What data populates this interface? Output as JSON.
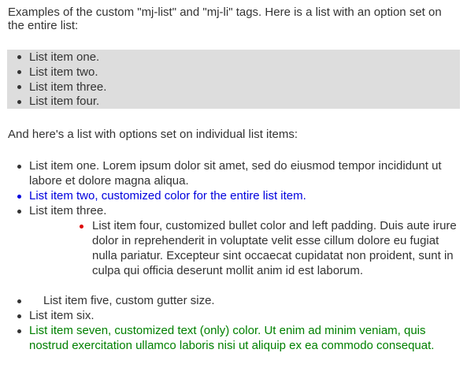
{
  "intro": "Examples of the custom \"mj-list\" and \"mj-li\" tags. Here is a list with an option set on the entire list:",
  "list1": {
    "items": [
      "List item one.",
      "List item two.",
      "List item three.",
      "List item four."
    ]
  },
  "para2": "And here's a list with options set on individual list items:",
  "list2": {
    "item1": "List item one. Lorem ipsum dolor sit amet, sed do eiusmod tempor incididunt ut labore et dolore magna aliqua.",
    "item2": "List item two, customized color for the entire list item.",
    "item3": "List item three.",
    "item4": "List item four, customized bullet color and left padding. Duis aute irure dolor in reprehenderit in voluptate velit esse cillum dolore eu fugiat nulla pariatur. Excepteur sint occaecat cupidatat non proident, sunt in culpa qui officia deserunt mollit anim id est laborum.",
    "item5": "List item five, custom gutter size.",
    "item6": "List item six.",
    "item7": "List item seven, customized text (only) color. Ut enim ad minim veniam, quis nostrud exercitation ullamco laboris nisi ut aliquip ex ea commodo consequat."
  },
  "colors": {
    "text": "#333333",
    "list_background": "#dddddd",
    "item2_color": "#0000dd",
    "item4_bullet": "#dd0000",
    "item7_color": "#008000"
  }
}
